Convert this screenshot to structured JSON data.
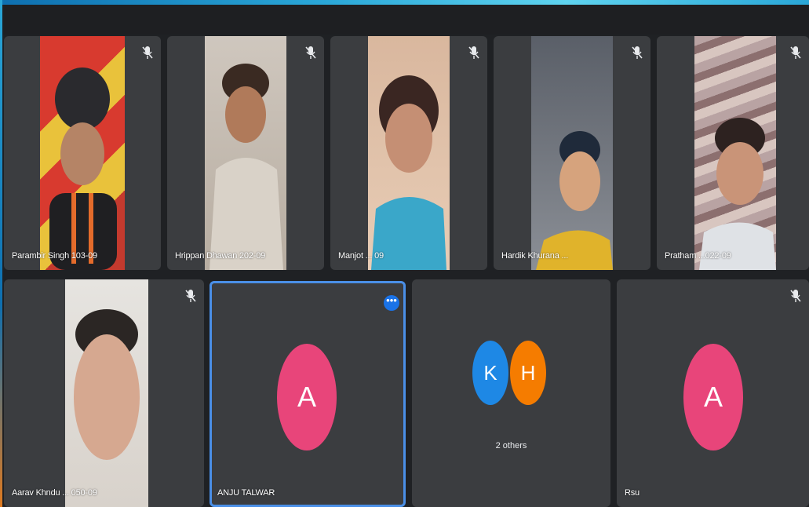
{
  "participants": [
    {
      "name": "Parambir Singh 103-09",
      "muted": true
    },
    {
      "name": "Hrippan Dhawan 202-09",
      "muted": true
    },
    {
      "name": "Manjot ... 09",
      "muted": true
    },
    {
      "name": "Hardik Khurana ...",
      "muted": true
    },
    {
      "name": "Pratham ...022-09",
      "muted": true
    },
    {
      "name": "Aarav Khndu ... 050-09",
      "muted": true
    },
    {
      "name": "ANJU TALWAR",
      "avatar_letter": "A",
      "avatar_color": "#e8457a",
      "muted": false,
      "more_label": "•••"
    },
    {
      "name": "",
      "avatar_letters": [
        "K",
        "H"
      ],
      "avatar_colors": [
        "#1e88e5",
        "#f57c00"
      ],
      "others_label": "2 others"
    },
    {
      "name": "Rsu",
      "avatar_letter": "A",
      "avatar_color": "#e8457a",
      "muted": true
    }
  ],
  "colors": {
    "background": "#1f2124",
    "tile": "#3b3d40",
    "selected_outline": "#4a8fe7",
    "frame_accent": "#2aa7d8"
  },
  "icons": {
    "mic_off": "mic-off-icon",
    "more": "more-options-icon"
  }
}
